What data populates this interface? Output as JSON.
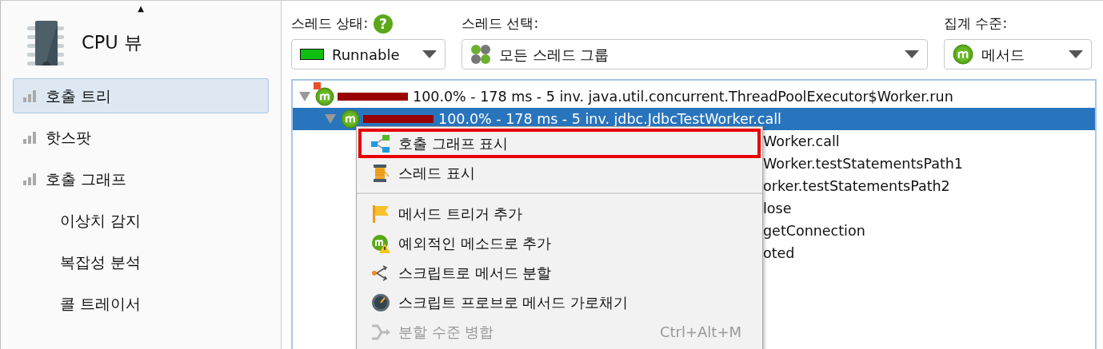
{
  "sidebar": {
    "scroll_up": "▲",
    "header": "CPU 뷰",
    "items": [
      {
        "label": "호출 트리",
        "selected": true,
        "kind": "bars"
      },
      {
        "label": "핫스팟",
        "selected": false,
        "kind": "bars"
      },
      {
        "label": "호출 그래프",
        "selected": false,
        "kind": "bars"
      },
      {
        "label": "이상치 감지",
        "selected": false,
        "kind": "plain"
      },
      {
        "label": "복잡성 분석",
        "selected": false,
        "kind": "plain"
      },
      {
        "label": "콜 트레이서",
        "selected": false,
        "kind": "plain"
      }
    ]
  },
  "filters": [
    {
      "label": "스레드 상태:",
      "help": "?",
      "value": "Runnable",
      "kind": "state"
    },
    {
      "label": "스레드 선택:",
      "value": "모든 스레드 그룹",
      "kind": "threads"
    },
    {
      "label": "집계 수준:",
      "value": "메서드",
      "kind": "method"
    }
  ],
  "tree": {
    "rows": [
      {
        "kind": "node",
        "text": "100.0% - 178 ms - 5 inv. java.util.concurrent.ThreadPoolExecutor$Worker.run",
        "expanded": true,
        "selected": false,
        "children": [
          {
            "kind": "node",
            "text": "100.0% - 178 ms - 5 inv. jdbc.JdbcTestWorker.call",
            "expanded": true,
            "selected": true,
            "children": [
              {
                "kind": "partial",
                "text": "Worker.call",
                "selected": false
              },
              {
                "kind": "partial",
                "text": "Worker.testStatementsPath1",
                "selected": false
              },
              {
                "kind": "partial",
                "text": "orker.testStatementsPath2",
                "selected": false
              },
              {
                "kind": "partial",
                "text": "lose",
                "selected": false
              },
              {
                "kind": "partial",
                "text": "getConnection",
                "selected": false
              },
              {
                "kind": "partial",
                "text": "oted",
                "selected": false
              }
            ]
          }
        ]
      }
    ]
  },
  "context_menu": {
    "items": [
      {
        "kind": "item",
        "label": "호출 그래프 표시",
        "selected": true,
        "disabled": false
      },
      {
        "kind": "item",
        "label": "스레드 표시",
        "selected": false,
        "disabled": false
      },
      {
        "kind": "separator"
      },
      {
        "kind": "item",
        "label": "메서드 트리거 추가",
        "selected": false,
        "disabled": false
      },
      {
        "kind": "item",
        "label": "예외적인 메소드로 추가",
        "selected": false,
        "disabled": false
      },
      {
        "kind": "item",
        "label": "스크립트로 메서드 분할",
        "selected": false,
        "disabled": false
      },
      {
        "kind": "item",
        "label": "스크립트 프로브로 메서드 가로채기",
        "selected": false,
        "disabled": false
      },
      {
        "kind": "item",
        "label": "분할 수준 병합",
        "shortcut": "Ctrl+Alt+M",
        "selected": false,
        "disabled": true
      }
    ]
  }
}
